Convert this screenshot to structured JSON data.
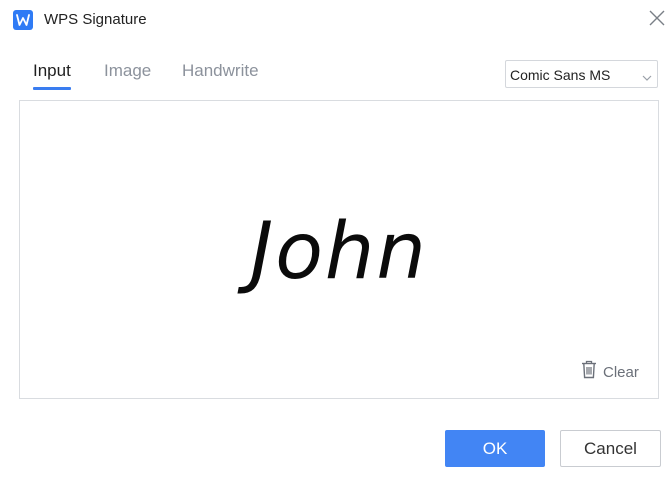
{
  "window": {
    "title": "WPS Signature"
  },
  "tabs": [
    {
      "label": "Input",
      "active": true
    },
    {
      "label": "Image",
      "active": false
    },
    {
      "label": "Handwrite",
      "active": false
    }
  ],
  "font_select": {
    "value": "Comic Sans MS"
  },
  "signature": {
    "text": "John"
  },
  "canvas": {
    "clear_label": "Clear"
  },
  "buttons": {
    "ok": "OK",
    "cancel": "Cancel"
  },
  "colors": {
    "accent": "#4285f4",
    "tab_underline": "#3a7df0",
    "app_logo": "#2f7bf5"
  },
  "icons": {
    "app": "wps-logo-icon",
    "close": "close-icon",
    "dropdown": "chevron-down-icon",
    "clear": "trash-icon"
  }
}
